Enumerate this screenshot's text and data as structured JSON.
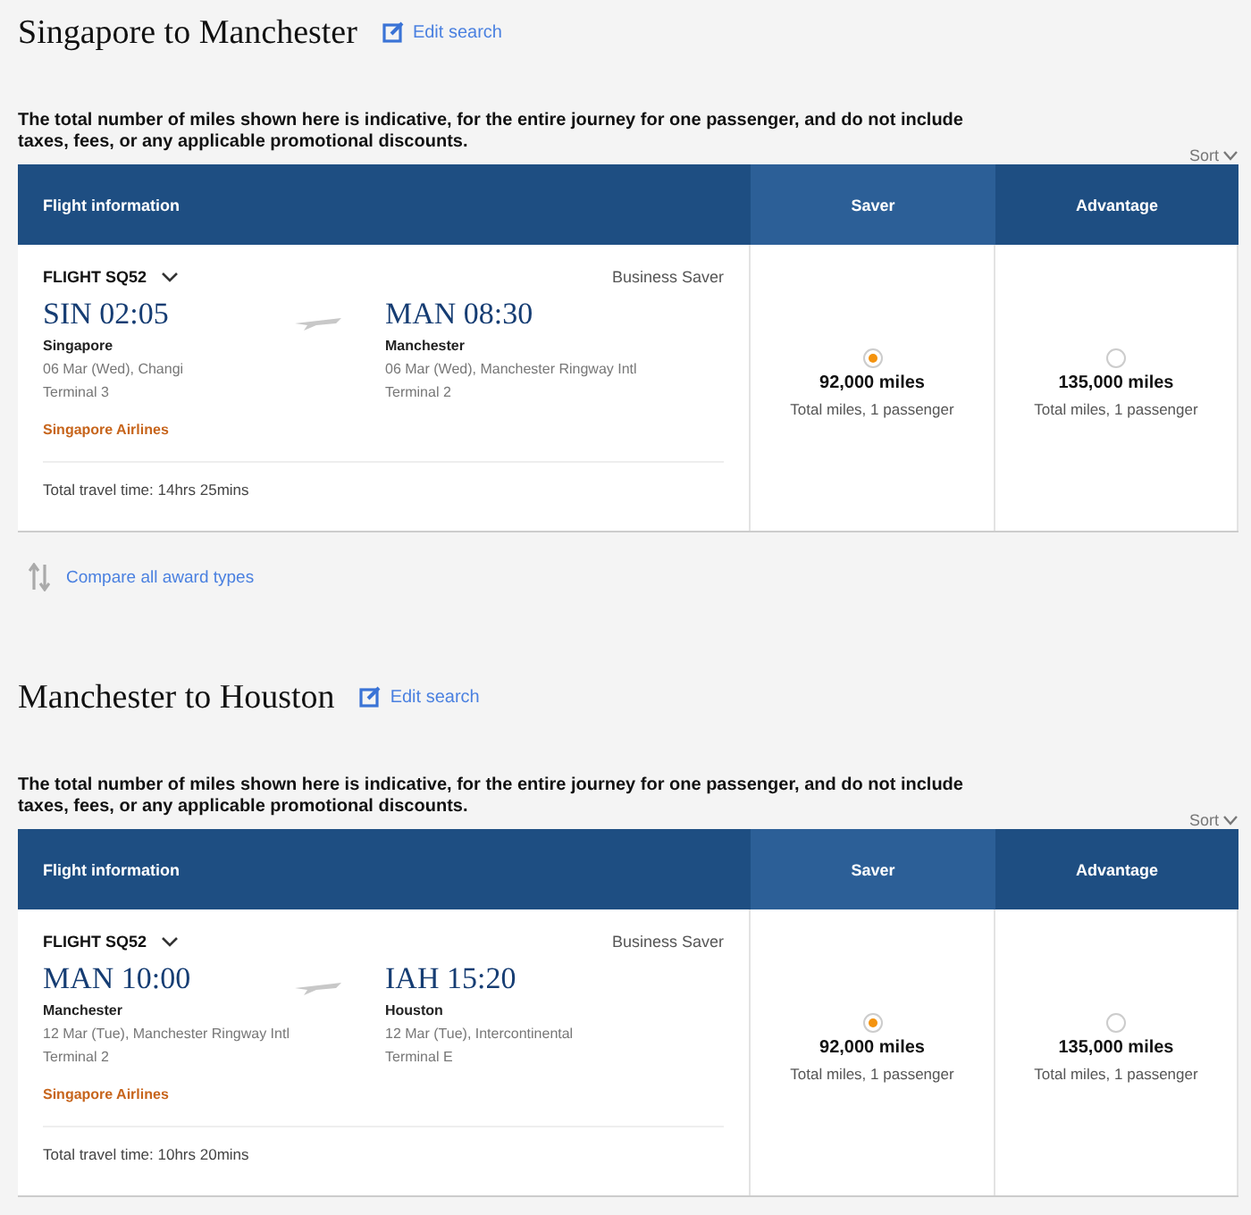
{
  "sections": [
    {
      "title": "Singapore to Manchester",
      "edit_link": "Edit search",
      "notice": "The total number of miles shown here is indicative, for the entire journey for one passenger, and do not include taxes, fees, or any applicable promotional discounts.",
      "sort": "Sort",
      "columns": [
        {
          "label": "Flight information"
        },
        {
          "label": "Saver"
        },
        {
          "label": "Advantage"
        }
      ],
      "flight": {
        "number": "FLIGHT SQ52",
        "expanded": false,
        "cabin": "Business Saver",
        "departure": {
          "code_time": "SIN 02:05",
          "city": "Singapore",
          "date_airport": "06 Mar (Wed), Changi",
          "terminal": "Terminal 3"
        },
        "arrival": {
          "code_time": "MAN 08:30",
          "city": "Manchester",
          "date_airport": "06 Mar (Wed), Manchester Ringway Intl",
          "terminal": "Terminal 2"
        },
        "airline": "Singapore Airlines",
        "travel_time": "Total travel time: 14hrs 25mins"
      },
      "fares": [
        {
          "miles": "92,000 miles",
          "note": "Total miles, 1 passenger",
          "selected": true
        },
        {
          "miles": "135,000 miles",
          "note": "Total miles, 1 passenger",
          "selected": false
        }
      ],
      "compare_link": "Compare all award types"
    },
    {
      "title": "Manchester to Houston",
      "edit_link": "Edit search",
      "notice": "The total number of miles shown here is indicative, for the entire journey for one passenger, and do not include taxes, fees, or any applicable promotional discounts.",
      "sort": "Sort",
      "columns": [
        {
          "label": "Flight information"
        },
        {
          "label": "Saver"
        },
        {
          "label": "Advantage"
        }
      ],
      "flight": {
        "number": "FLIGHT SQ52",
        "expanded": false,
        "cabin": "Business Saver",
        "departure": {
          "code_time": "MAN 10:00",
          "city": "Manchester",
          "date_airport": "12 Mar (Tue), Manchester Ringway Intl",
          "terminal": "Terminal 2"
        },
        "arrival": {
          "code_time": "IAH 15:20",
          "city": "Houston",
          "date_airport": "12 Mar (Tue), Intercontinental",
          "terminal": "Terminal E"
        },
        "airline": "Singapore Airlines",
        "travel_time": "Total travel time: 10hrs 20mins"
      },
      "fares": [
        {
          "miles": "92,000 miles",
          "note": "Total miles, 1 passenger",
          "selected": true
        },
        {
          "miles": "135,000 miles",
          "note": "Total miles, 1 passenger",
          "selected": false
        }
      ]
    }
  ]
}
